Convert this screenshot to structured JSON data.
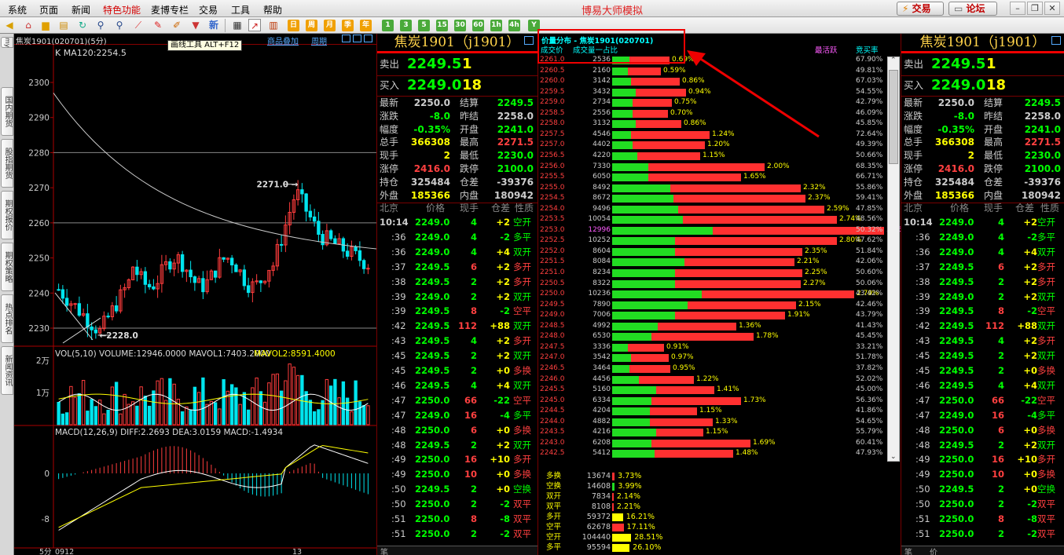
{
  "menu": {
    "items": [
      "系统",
      "页面",
      "新闻",
      "特色功能",
      "麦博专栏",
      "交易",
      "工具",
      "帮助"
    ],
    "app_title": "博易大师模拟",
    "trade_btn": "交易",
    "forum_btn": "论坛"
  },
  "toolbar": {
    "period_icons": [
      "日",
      "周",
      "月",
      "季",
      "年"
    ],
    "num_icons": [
      "1",
      "3",
      "5",
      "15",
      "30",
      "60",
      "1h",
      "4h",
      "Y"
    ],
    "tooltip": "画线工具 ALT+F12",
    "new_icon": "新"
  },
  "ltabs": [
    "国内期货",
    "股指期货",
    "期权报价",
    "期权策略",
    "热点排名",
    "新闻资讯"
  ],
  "chart": {
    "header_name": "焦炭1901(020701)(5分)",
    "header_links": [
      "商品叠加",
      "周期"
    ],
    "ma_label": "K  MA120:2254.5",
    "y_ticks": [
      "2300",
      "2290",
      "2280",
      "2270",
      "2260",
      "2250",
      "2240",
      "2230"
    ],
    "high_label": "2271.0",
    "low_label": "2228.0",
    "vol_label": "VOL(5,10) VOLUME:12946.0000 MAVOL1:7403.2000",
    "vol_label2": "MAVOL2:8591.4000",
    "vol_ticks": [
      "2万",
      "1万"
    ],
    "macd_label": "MACD(12,26,9) DIFF:2.2693 DEA:3.0159 MACD:-1.4934",
    "macd_ticks": [
      "0",
      "-8"
    ],
    "x_labels": [
      "5分",
      "0912",
      "13"
    ]
  },
  "quote": {
    "title": "焦炭1901（j1901）",
    "sell_label": "卖出",
    "sell_price": "2249.5",
    "sell_vol": "1",
    "buy_label": "买入",
    "buy_price": "2249.0",
    "buy_vol": "18",
    "stats": [
      [
        "最新",
        "2250.0",
        "结算",
        "2249.5"
      ],
      [
        "涨跌",
        "-8.0",
        "昨结",
        "2258.0"
      ],
      [
        "幅度",
        "-0.35%",
        "开盘",
        "2241.0"
      ],
      [
        "总手",
        "366308",
        "最高",
        "2271.5"
      ],
      [
        "现手",
        "2",
        "最低",
        "2230.0"
      ],
      [
        "涨停",
        "2416.0",
        "跌停",
        "2100.0"
      ],
      [
        "持仓",
        "325484",
        "仓差",
        "-39376"
      ],
      [
        "外盘",
        "185366",
        "内盘",
        "180942"
      ]
    ],
    "tick_headers": [
      "北京",
      "价格",
      "现手",
      "仓差",
      "性质"
    ],
    "ticks": [
      [
        "10:14",
        "2249.0",
        "4",
        "+2",
        "空开"
      ],
      [
        ":36",
        "2249.0",
        "4",
        "-2",
        "多平"
      ],
      [
        ":36",
        "2249.0",
        "4",
        "+4",
        "双开"
      ],
      [
        ":37",
        "2249.5",
        "6",
        "+2",
        "多开"
      ],
      [
        ":38",
        "2249.5",
        "2",
        "+2",
        "多开"
      ],
      [
        ":39",
        "2249.0",
        "2",
        "+2",
        "双开"
      ],
      [
        ":39",
        "2249.5",
        "8",
        "-2",
        "空平"
      ],
      [
        ":42",
        "2249.5",
        "112",
        "+88",
        "双开"
      ],
      [
        ":43",
        "2249.5",
        "4",
        "+2",
        "多开"
      ],
      [
        ":45",
        "2249.5",
        "2",
        "+2",
        "双开"
      ],
      [
        ":45",
        "2249.5",
        "2",
        "+0",
        "多换"
      ],
      [
        ":46",
        "2249.5",
        "4",
        "+4",
        "双开"
      ],
      [
        ":47",
        "2250.0",
        "66",
        "-22",
        "空平"
      ],
      [
        ":47",
        "2249.0",
        "16",
        "-4",
        "多平"
      ],
      [
        ":48",
        "2250.0",
        "6",
        "+0",
        "多换"
      ],
      [
        ":48",
        "2249.5",
        "2",
        "+2",
        "双开"
      ],
      [
        ":49",
        "2250.0",
        "16",
        "+10",
        "多开"
      ],
      [
        ":49",
        "2250.0",
        "10",
        "+0",
        "多换"
      ],
      [
        ":50",
        "2249.5",
        "2",
        "+0",
        "空换"
      ],
      [
        ":50",
        "2250.0",
        "2",
        "-2",
        "双平"
      ],
      [
        ":51",
        "2250.0",
        "8",
        "-8",
        "双平"
      ],
      [
        ":51",
        "2250.0",
        "2",
        "-2",
        "双平"
      ]
    ],
    "bottom_tabs": [
      "笔",
      "价"
    ]
  },
  "pd": {
    "title": "价量分布 - 焦炭1901(020701)",
    "col_price": "成交价",
    "col_vol": "成交量一占比",
    "col_active": "最活跃",
    "col_ratio": "竞买率",
    "rows": [
      [
        "2261.0",
        "2536",
        22,
        51,
        "0.69%",
        "67.90%"
      ],
      [
        "2260.5",
        "2160",
        20,
        42,
        "0.59%",
        "49.81%"
      ],
      [
        "2260.0",
        "3142",
        24,
        62,
        "0.86%",
        "67.03%"
      ],
      [
        "2259.5",
        "3432",
        30,
        64,
        "0.94%",
        "54.55%"
      ],
      [
        "2259.0",
        "2734",
        26,
        50,
        "0.75%",
        "42.79%"
      ],
      [
        "2258.5",
        "2556",
        26,
        45,
        "0.70%",
        "46.09%"
      ],
      [
        "2258.0",
        "3132",
        30,
        58,
        "0.86%",
        "45.85%"
      ],
      [
        "2257.5",
        "4546",
        24,
        100,
        "1.24%",
        "72.64%"
      ],
      [
        "2257.0",
        "4402",
        26,
        92,
        "1.20%",
        "49.39%"
      ],
      [
        "2256.5",
        "4220",
        32,
        80,
        "1.15%",
        "50.66%"
      ],
      [
        "2256.0",
        "7330",
        46,
        148,
        "2.00%",
        "68.35%"
      ],
      [
        "2255.5",
        "6050",
        46,
        118,
        "1.65%",
        "66.71%"
      ],
      [
        "2255.0",
        "8492",
        74,
        166,
        "2.32%",
        "55.86%"
      ],
      [
        "2254.5",
        "8672",
        78,
        168,
        "2.37%",
        "59.41%"
      ],
      [
        "2254.0",
        "9496",
        84,
        186,
        "2.59%",
        "47.85%"
      ],
      [
        "2253.5",
        "10054",
        90,
        196,
        "2.74%",
        "48.56%"
      ],
      [
        "2253.0",
        "12996",
        128,
        218,
        "3.55%",
        "50.32%"
      ],
      [
        "2252.5",
        "10252",
        80,
        206,
        "2.80%",
        "47.62%"
      ],
      [
        "2252.0",
        "8604",
        80,
        162,
        "2.35%",
        "51.84%"
      ],
      [
        "2251.5",
        "8084",
        92,
        140,
        "2.21%",
        "42.06%"
      ],
      [
        "2251.0",
        "8234",
        80,
        162,
        "2.25%",
        "50.60%"
      ],
      [
        "2250.5",
        "8322",
        80,
        160,
        "2.27%",
        "50.06%"
      ],
      [
        "2250.0",
        "10236",
        114,
        194,
        "2.79%",
        "43.42%"
      ],
      [
        "2249.5",
        "7890",
        96,
        138,
        "2.15%",
        "42.46%"
      ],
      [
        "2249.0",
        "7006",
        80,
        140,
        "1.91%",
        "43.79%"
      ],
      [
        "2248.5",
        "4992",
        58,
        100,
        "1.36%",
        "41.43%"
      ],
      [
        "2248.0",
        "6530",
        50,
        130,
        "1.78%",
        "45.45%"
      ],
      [
        "2247.5",
        "3336",
        20,
        46,
        "0.91%",
        "33.21%"
      ],
      [
        "2247.0",
        "3542",
        24,
        48,
        "0.97%",
        "51.78%"
      ],
      [
        "2246.5",
        "3464",
        22,
        52,
        "0.95%",
        "37.82%"
      ],
      [
        "2246.0",
        "4456",
        34,
        70,
        "1.22%",
        "52.02%"
      ],
      [
        "2245.5",
        "5160",
        56,
        74,
        "1.41%",
        "45.00%"
      ],
      [
        "2245.0",
        "6334",
        50,
        114,
        "1.73%",
        "56.36%"
      ],
      [
        "2244.5",
        "4204",
        48,
        60,
        "1.15%",
        "41.86%"
      ],
      [
        "2244.0",
        "4882",
        48,
        80,
        "1.33%",
        "54.65%"
      ],
      [
        "2243.5",
        "4216",
        56,
        60,
        "1.15%",
        "55.79%"
      ],
      [
        "2243.0",
        "6208",
        50,
        126,
        "1.69%",
        "60.41%"
      ],
      [
        "2242.5",
        "5412",
        54,
        100,
        "1.48%",
        "47.93%"
      ]
    ],
    "nature_rows": [
      [
        "多换",
        "13674",
        3.73,
        "3.73%",
        "#ff3030"
      ],
      [
        "空换",
        "14608",
        3.99,
        "3.99%",
        "#22dd22"
      ],
      [
        "双开",
        "7834",
        2.14,
        "2.14%",
        "#ff3030"
      ],
      [
        "双平",
        "8108",
        2.21,
        "2.21%",
        "#ff3030"
      ],
      [
        "多开",
        "59372",
        16.21,
        "16.21%",
        "#ff0"
      ],
      [
        "空平",
        "62678",
        17.11,
        "17.11%",
        "#ff3030"
      ],
      [
        "空开",
        "104440",
        28.51,
        "28.51%",
        "#ff0"
      ],
      [
        "多平",
        "95594",
        26.1,
        "26.10%",
        "#ff0"
      ]
    ]
  },
  "colors": {
    "red": "#ff4040",
    "green": "#00ff00",
    "yellow": "#ffff00",
    "bg": "#000000"
  }
}
